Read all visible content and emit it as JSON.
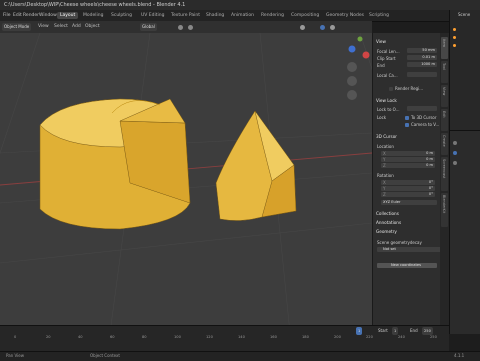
{
  "window": {
    "title": "C:\\Users\\Desktop\\WIP\\Cheese wheels\\cheese wheels.blend - Blender 4.1"
  },
  "menu": [
    "File",
    "Edit",
    "Render",
    "Window",
    "Help"
  ],
  "workspaces": [
    "Layout",
    "Modeling",
    "Sculpting",
    "UV Editing",
    "Texture Paint",
    "Shading",
    "Animation",
    "Rendering",
    "Compositing",
    "Geometry Nodes",
    "Scripting"
  ],
  "header": {
    "mode": "Object Mode",
    "view": "View",
    "select": "Select",
    "add": "Add",
    "object": "Object",
    "select_box": "Select Box",
    "orientation": "Global"
  },
  "sidebar": {
    "tabs": [
      "Item",
      "Tool",
      "View",
      "Edit",
      "Create",
      "Screencast",
      "BlenderKit"
    ],
    "view_section": "View",
    "focal_label": "Focal Len...",
    "focal_value": "50 mm",
    "clip_start_label": "Clip Start",
    "clip_start_value": "0.01 m",
    "clip_end_label": "End",
    "clip_end_value": "1000 m",
    "local_camera_label": "Local Ca...",
    "render_region_label": "Render Regi...",
    "view_lock_section": "View Lock",
    "lock_object_label": "Lock to O...",
    "lock_label": "Lock",
    "to_3d_cursor": "To 3D Cursor",
    "camera_to_view": "Camera to V...",
    "cursor_section": "3D Cursor",
    "location_label": "Location",
    "loc": [
      {
        "axis": "X",
        "value": "0 m"
      },
      {
        "axis": "Y",
        "value": "0 m"
      },
      {
        "axis": "Z",
        "value": "0 m"
      }
    ],
    "rotation_label": "Rotation",
    "rot": [
      {
        "axis": "X",
        "value": "0°"
      },
      {
        "axis": "Y",
        "value": "0°"
      },
      {
        "axis": "Z",
        "value": "0°"
      }
    ],
    "rotation_mode": "XYZ Euler",
    "collections": "Collections",
    "annotations": "Annotations",
    "geometry": "Geometry",
    "scene_geometry_label": "Scene geometrydecay",
    "not_set": "Not set",
    "new_coordinates": "New coordinates"
  },
  "outliner": {
    "title": "Scene"
  },
  "timeline": {
    "ticks": [
      "0",
      "20",
      "40",
      "60",
      "80",
      "100",
      "120",
      "140",
      "160",
      "180",
      "200",
      "220",
      "240",
      "250"
    ],
    "current_frame": "1",
    "start_label": "Start",
    "start": "1",
    "end_label": "End",
    "end": "250"
  },
  "statusbar": {
    "pan": "Pan View",
    "context": "Object Context",
    "version": "4.1.1"
  },
  "colors": {
    "cheese": "#e8bb44",
    "select": "#4772b3",
    "accent": "#ffa030"
  }
}
